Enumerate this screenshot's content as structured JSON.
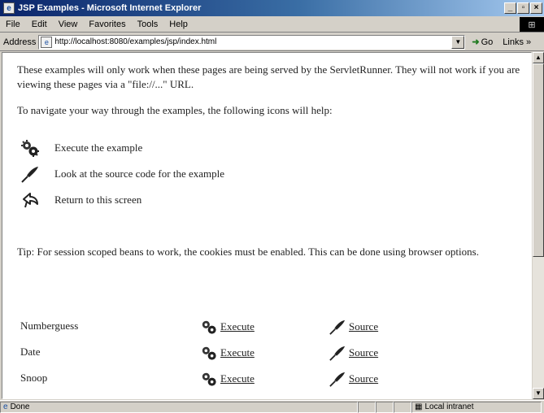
{
  "window": {
    "title": "JSP Examples - Microsoft Internet Explorer",
    "minimize": "_",
    "maximize": "▫",
    "close": "×"
  },
  "menu": {
    "items": [
      "File",
      "Edit",
      "View",
      "Favorites",
      "Tools",
      "Help"
    ]
  },
  "address": {
    "label": "Address",
    "url": "http://localhost:8080/examples/jsp/index.html",
    "go_label": "Go",
    "links_label": "Links »"
  },
  "content": {
    "intro": "These examples will only work when these pages are being served by the ServletRunner. They will not work if you are viewing these pages via a \"file://...\" URL.",
    "navigate": "To navigate your way through the examples, the following icons will help:",
    "legend": {
      "execute": "Execute the example",
      "source": "Look at the source code for the example",
      "return": "Return to this screen"
    },
    "tip": "Tip: For session scoped beans to work, the cookies must be enabled. This can be done using browser options.",
    "execute_link": "Execute",
    "source_link": "Source",
    "examples": [
      "Numberguess",
      "Date",
      "Snoop"
    ]
  },
  "status": {
    "text": "Done",
    "zone": "Local intranet"
  },
  "colors": {
    "titlebar_start": "#0a246a",
    "chrome": "#d4d0c8",
    "page_bg": "#ffffff"
  },
  "icons": {
    "execute": "gears-icon",
    "source": "quill-icon",
    "return": "return-arrow-icon"
  }
}
